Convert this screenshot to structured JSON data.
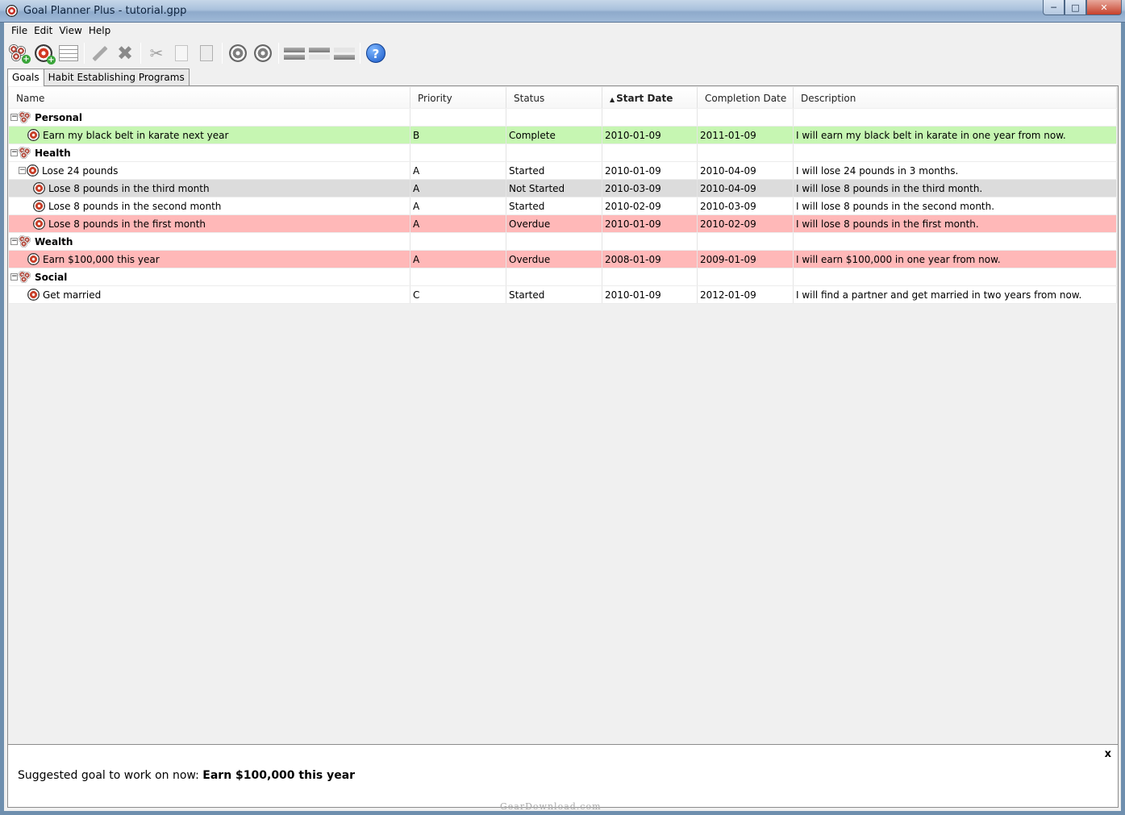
{
  "window": {
    "title": "Goal Planner Plus - tutorial.gpp",
    "minimize_glyph": "─",
    "maximize_glyph": "□",
    "close_glyph": "✕"
  },
  "menu": {
    "file": "File",
    "edit": "Edit",
    "view": "View",
    "help": "Help"
  },
  "toolbar": {
    "icons": [
      "add-group-icon",
      "add-goal-icon",
      "add-table-icon",
      "edit-icon",
      "delete-icon",
      "cut-icon",
      "copy-icon",
      "paste-icon",
      "goal-up-icon",
      "goal-down-icon",
      "move-up-icon",
      "move-top-icon",
      "move-down-icon",
      "help-icon"
    ],
    "help_glyph": "?"
  },
  "tabs": {
    "goals": "Goals",
    "habits": "Habit Establishing Programs"
  },
  "columns": {
    "name": "Name",
    "priority": "Priority",
    "status": "Status",
    "start_date": "Start Date",
    "completion_date": "Completion Date",
    "description": "Description",
    "sort_glyph": "▲"
  },
  "rows": [
    {
      "type": "group",
      "name": "Personal"
    },
    {
      "type": "goal",
      "name": "Earn my black belt in karate next year",
      "priority": "B",
      "status": "Complete",
      "start": "2010-01-09",
      "completion": "2011-01-09",
      "description": "I will earn my black belt in karate in one year from now.",
      "state": "complete"
    },
    {
      "type": "group",
      "name": "Health"
    },
    {
      "type": "goal",
      "name": "Lose 24 pounds",
      "priority": "A",
      "status": "Started",
      "start": "2010-01-09",
      "completion": "2010-04-09",
      "description": "I will lose 24 pounds in 3 months.",
      "state": "started"
    },
    {
      "type": "subgoal",
      "name": "Lose 8 pounds in the third month",
      "priority": "A",
      "status": "Not Started",
      "start": "2010-03-09",
      "completion": "2010-04-09",
      "description": "I will lose 8 pounds in the third month.",
      "state": "notstarted"
    },
    {
      "type": "subgoal",
      "name": "Lose 8 pounds in the second month",
      "priority": "A",
      "status": "Started",
      "start": "2010-02-09",
      "completion": "2010-03-09",
      "description": "I will lose 8 pounds in the second month.",
      "state": "started"
    },
    {
      "type": "subgoal",
      "name": "Lose 8 pounds in the first month",
      "priority": "A",
      "status": "Overdue",
      "start": "2010-01-09",
      "completion": "2010-02-09",
      "description": "I will lose 8 pounds in the first month.",
      "state": "overdue"
    },
    {
      "type": "group",
      "name": "Wealth"
    },
    {
      "type": "goal",
      "name": "Earn $100,000 this year",
      "priority": "A",
      "status": "Overdue",
      "start": "2008-01-09",
      "completion": "2009-01-09",
      "description": "I will earn $100,000 in one year from now.",
      "state": "overdue"
    },
    {
      "type": "group",
      "name": "Social"
    },
    {
      "type": "goal",
      "name": "Get married",
      "priority": "C",
      "status": "Started",
      "start": "2010-01-09",
      "completion": "2012-01-09",
      "description": "I will find a partner and get married in two years from now.",
      "state": "started"
    }
  ],
  "suggestion": {
    "prefix": "Suggested goal to work on now:",
    "goal": "Earn $100,000 this year",
    "close": "x"
  },
  "watermark": "GearDownload.com",
  "colors": {
    "complete": "#c6f6b2",
    "overdue": "#ffb8b8",
    "not_started": "#dcdcdc"
  }
}
